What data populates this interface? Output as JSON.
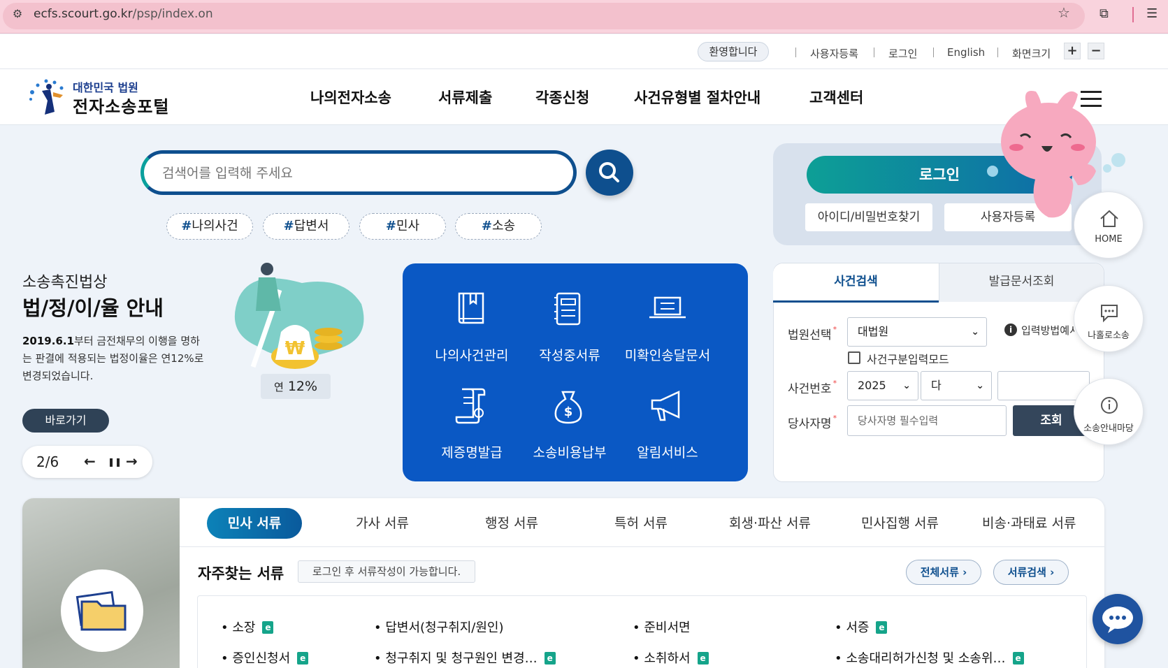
{
  "browser": {
    "url_host": "ecfs.scourt.go.kr",
    "url_path": "/psp/index.on"
  },
  "util": {
    "welcome": "환영합니다",
    "links": [
      "사용자등록",
      "로그인",
      "English",
      "화면크기"
    ],
    "zoom_in": "+",
    "zoom_out": "−"
  },
  "logo": {
    "top": "대한민국 법원",
    "main": "전자소송포털"
  },
  "gnb": [
    "나의전자소송",
    "서류제출",
    "각종신청",
    "사건유형별 절차안내",
    "고객센터"
  ],
  "search": {
    "placeholder": "검색어를 입력해 주세요",
    "tags": [
      "나의사건",
      "답변서",
      "민사",
      "소송"
    ],
    "hash": "#"
  },
  "promo": {
    "subtitle": "소송촉진법상",
    "title": "법/정/이/율 안내",
    "desc_bold": "2019.6.1",
    "desc": "부터 금전채무의 이행을 명하는 판결에 적용되는 법정이율은 연12%로 변경되었습니다.",
    "rate_prefix": "연",
    "rate": "12%",
    "go": "바로가기",
    "page": "2/6",
    "prev": "←",
    "pause": "❚❚",
    "next": "→"
  },
  "quick": [
    "나의사건관리",
    "작성중서류",
    "미확인송달문서",
    "제증명발급",
    "소송비용납부",
    "알림서비스"
  ],
  "login": {
    "button": "로그인",
    "find": "아이디/비밀번호찾기",
    "register": "사용자등록"
  },
  "case_search": {
    "tab_case": "사건검색",
    "tab_issue": "발급문서조회",
    "court_label": "법원선택",
    "court_value": "대법원",
    "info": "입력방법예시",
    "mode_label": "사건구분입력모드",
    "case_no_label": "사건번호",
    "year": "2025",
    "type": "다",
    "party_label": "당사자명",
    "party_placeholder": "당사자명 필수입력",
    "query": "조회"
  },
  "side_quick": [
    "HOME",
    "나홀로소송",
    "소송안내마당"
  ],
  "doc_tabs": [
    "민사 서류",
    "가사 서류",
    "행정 서류",
    "특허 서류",
    "회생·파산 서류",
    "민사집행 서류",
    "비송·과태료 서류"
  ],
  "freq": {
    "title": "자주찾는 서류",
    "note": "로그인 후 서류작성이 가능합니다.",
    "all": "전체서류",
    "find": "서류검색"
  },
  "docs": [
    "소장",
    "답변서(청구취지/원인)",
    "준비서면",
    "서증",
    "증인신청서",
    "청구취지 및 청구원인 변경…",
    "소취하서",
    "소송대리허가신청 및 소송위…"
  ],
  "doc_icon": "e",
  "colors": {
    "navy": "#0e4f8e",
    "blue_panel": "#0a58c4",
    "teal": "#0d9f96",
    "dark_btn": "#34465b"
  }
}
